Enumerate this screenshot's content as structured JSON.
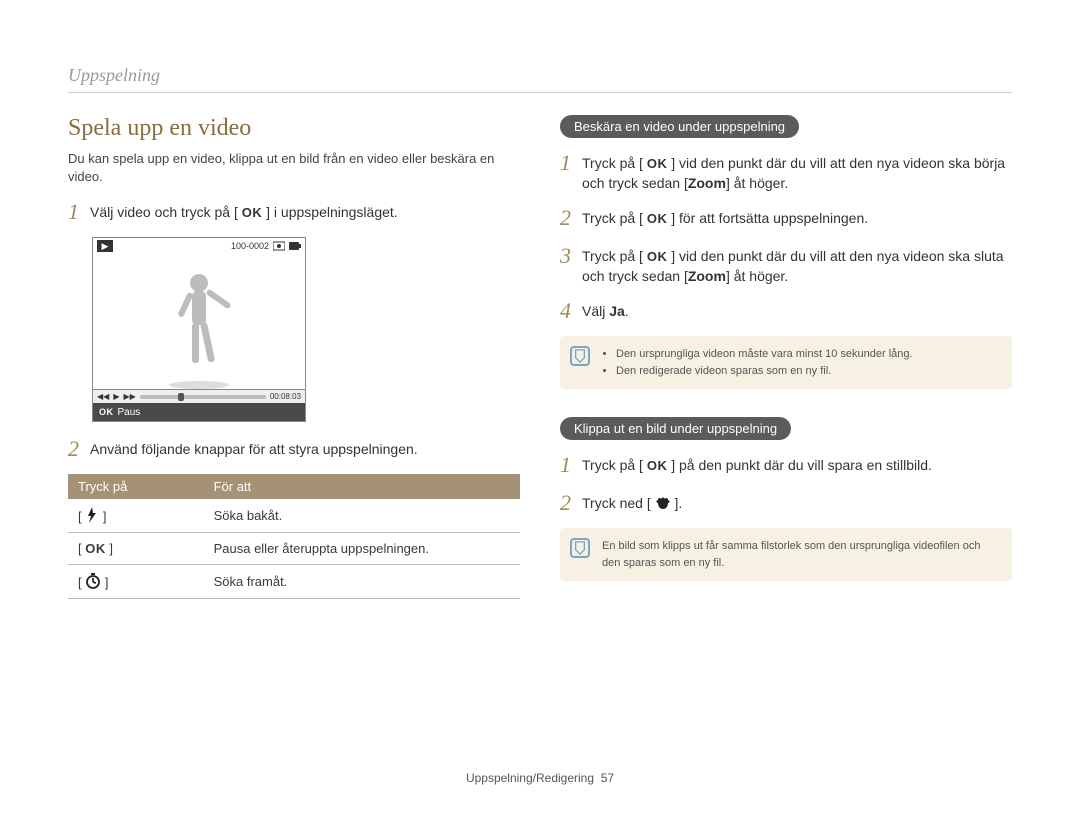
{
  "section_title": "Uppspelning",
  "left": {
    "heading": "Spela upp en video",
    "intro": "Du kan spela upp en video, klippa ut en bild från en video eller beskära en video.",
    "step1_pre": "Välj video och tryck på [",
    "step1_post": "] i uppspelningsläget.",
    "player": {
      "counter": "100-0002",
      "time": "00:08:03",
      "paus": "Paus"
    },
    "step2": "Använd följande knappar för att styra uppspelningen.",
    "table": {
      "h1": "Tryck på",
      "h2": "För att",
      "r1": "Söka bakåt.",
      "r2": "Pausa eller återuppta uppspelningen.",
      "r3": "Söka framåt."
    }
  },
  "right": {
    "trim_title": "Beskära en video under uppspelning",
    "t1a": "Tryck på [",
    "t1b": "] vid den punkt där du vill att den nya videon ska börja och tryck sedan [",
    "t1c": "Zoom",
    "t1d": "] åt höger.",
    "t2a": "Tryck på [",
    "t2b": "] för att fortsätta uppspelningen.",
    "t3a": "Tryck på [",
    "t3b": "] vid den punkt där du vill att den nya videon ska sluta och tryck sedan [",
    "t3c": "Zoom",
    "t3d": "] åt höger.",
    "t4a": "Välj ",
    "t4b": "Ja",
    "t4c": ".",
    "note1a": "Den ursprungliga videon måste vara minst 10 sekunder lång.",
    "note1b": "Den redigerade videon sparas som en ny fil.",
    "clip_title": "Klippa ut en bild under uppspelning",
    "c1a": "Tryck på [",
    "c1b": "] på den punkt där du vill spara en stillbild.",
    "c2a": "Tryck ned [",
    "c2b": "].",
    "note2": "En bild som klipps ut får samma filstorlek som den ursprungliga videofilen och den sparas som en ny fil."
  },
  "footer": {
    "text": "Uppspelning/Redigering",
    "page": "57"
  }
}
